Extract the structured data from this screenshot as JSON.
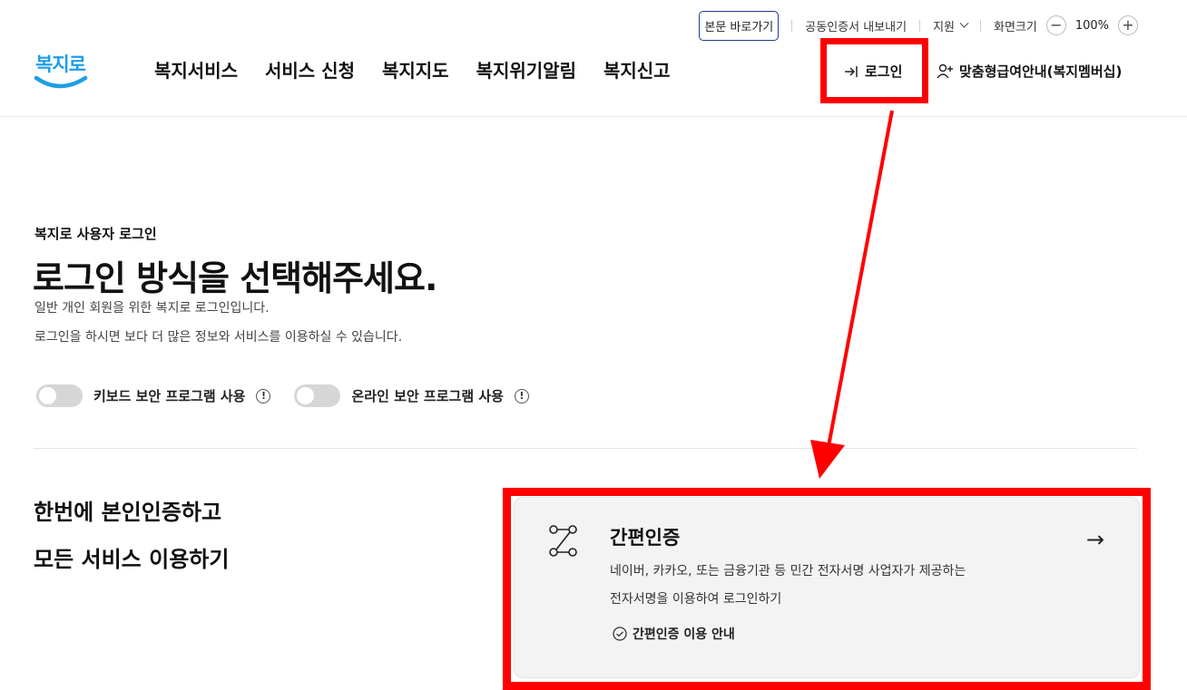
{
  "util": {
    "skip_label": "본문 바로가기",
    "cert_export": "공동인증서 내보내기",
    "support": "지원",
    "zoom_label": "화면크기",
    "zoom_minus": "−",
    "zoom_value": "100%",
    "zoom_plus": "+"
  },
  "header": {
    "logo_text": "복지로",
    "nav": [
      "복지서비스",
      "서비스 신청",
      "복지지도",
      "복지위기알림",
      "복지신고"
    ],
    "login": "로그인",
    "member": "맞춤형급여안내(복지멤버십)"
  },
  "login": {
    "eyebrow": "복지로 사용자 로그인",
    "title": "로그인 방식을 선택해주세요.",
    "desc1": "일반 개인 회원을 위한 복지로 로그인입니다.",
    "desc2": "로그인을 하시면 보다 더 많은 정보와 서비스를 이용하실 수 있습니다.",
    "toggles": [
      {
        "label": "키보드 보안 프로그램 사용",
        "on": false
      },
      {
        "label": "온라인 보안 프로그램 사용",
        "on": false
      }
    ],
    "info_glyph": "!"
  },
  "side": {
    "line1": "한번에 본인인증하고",
    "line2": "모든 서비스 이용하기"
  },
  "card": {
    "title": "간편인증",
    "desc1": "네이버, 카카오, 또는 금융기관 등 민간 전자서명 사업자가 제공하는",
    "desc2": "전자서명을 이용하여 로그인하기",
    "guide": "간편인증 이용 안내",
    "arrow": "→"
  },
  "colors": {
    "brand_blue": "#1e9ee6",
    "highlight_red": "#ff0000",
    "skip_border": "#1e3a8a"
  }
}
